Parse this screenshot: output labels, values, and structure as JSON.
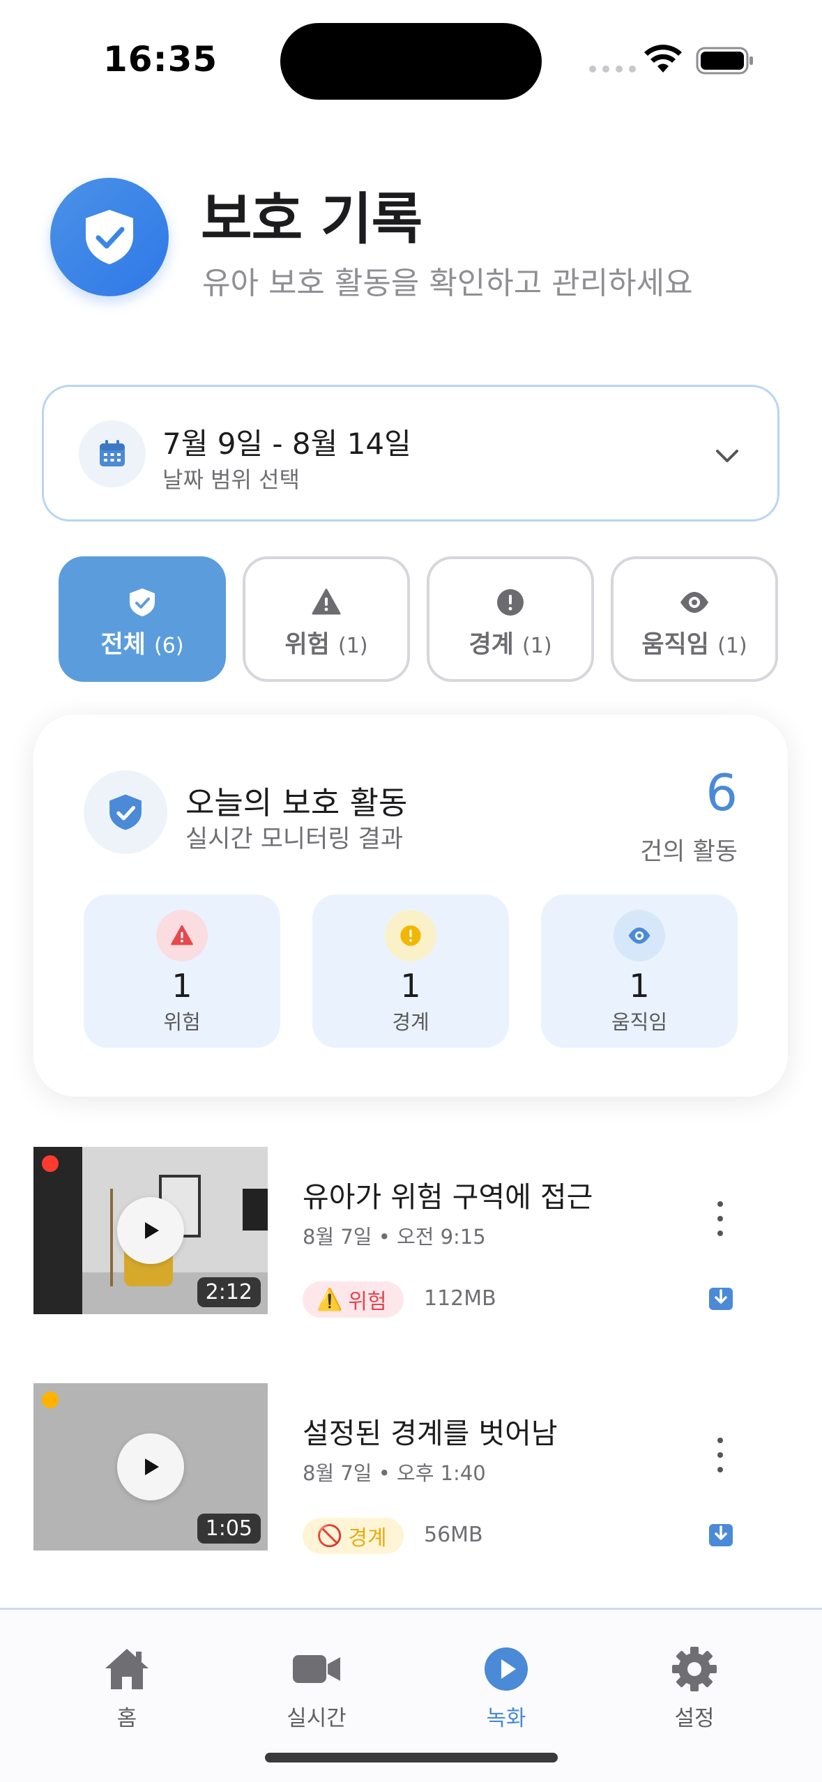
{
  "status_bar": {
    "time": "16:35"
  },
  "header": {
    "title": "보호 기록",
    "subtitle": "유아 보호 활동을 확인하고 관리하세요",
    "icon": "shield-check-icon",
    "accent": "#3a86e8"
  },
  "date_range": {
    "value": "7월 9일 - 8월 14일",
    "label": "날짜 범위 선택"
  },
  "filters": [
    {
      "label": "전체",
      "count": "(6)",
      "icon": "shield-check-icon",
      "active": true
    },
    {
      "label": "위험",
      "count": "(1)",
      "icon": "warning-triangle-icon",
      "active": false
    },
    {
      "label": "경계",
      "count": "(1)",
      "icon": "exclamation-circle-icon",
      "active": false
    },
    {
      "label": "움직임",
      "count": "(1)",
      "icon": "eye-icon",
      "active": false
    }
  ],
  "summary": {
    "title": "오늘의 보호 활동",
    "subtitle": "실시간 모니터링 결과",
    "count": "6",
    "count_label": "건의 활동",
    "stats": [
      {
        "value": "1",
        "label": "위험",
        "icon": "warning-triangle-icon",
        "color": "#e5484d"
      },
      {
        "value": "1",
        "label": "경계",
        "icon": "exclamation-circle-icon",
        "color": "#f2b705"
      },
      {
        "value": "1",
        "label": "움직임",
        "icon": "eye-icon",
        "color": "#4a8ad6"
      }
    ]
  },
  "recordings": [
    {
      "title": "유아가 위험 구역에 접근",
      "date": "8월 7일",
      "time": "오전 9:15",
      "duration": "2:12",
      "tag": "위험",
      "tag_emoji": "⚠️",
      "size": "112MB",
      "dot_color": "#ff3b30"
    },
    {
      "title": "설정된 경계를 벗어남",
      "date": "8월 7일",
      "time": "오후 1:40",
      "duration": "1:05",
      "tag": "경계",
      "tag_emoji": "🚫",
      "size": "56MB",
      "dot_color": "#ffb300"
    }
  ],
  "tab_bar": [
    {
      "label": "홈",
      "icon": "home-icon",
      "active": false
    },
    {
      "label": "실시간",
      "icon": "video-camera-icon",
      "active": false
    },
    {
      "label": "녹화",
      "icon": "play-circle-icon",
      "active": true
    },
    {
      "label": "설정",
      "icon": "gear-icon",
      "active": false
    }
  ]
}
